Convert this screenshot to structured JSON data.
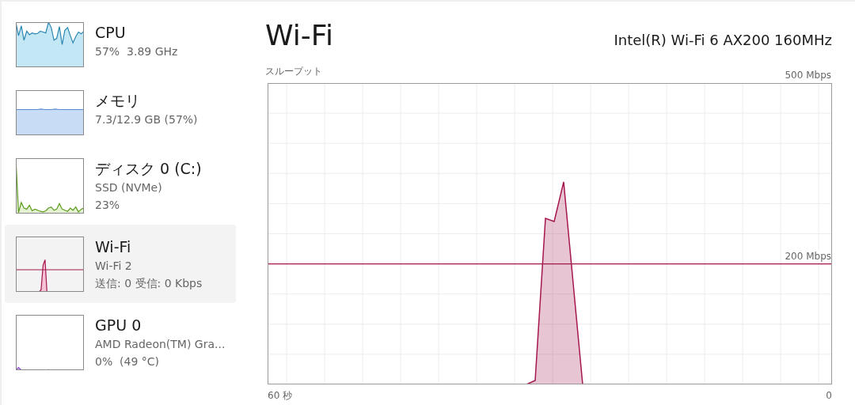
{
  "sidebar": {
    "items": [
      {
        "kind": "cpu",
        "title": "CPU",
        "lines": [
          "57%  3.89 GHz"
        ],
        "selected": false
      },
      {
        "kind": "memory",
        "title": "メモリ",
        "lines": [
          "7.3/12.9 GB (57%)"
        ],
        "selected": false
      },
      {
        "kind": "disk",
        "title": "ディスク 0 (C:)",
        "lines": [
          "SSD (NVMe)",
          "23%"
        ],
        "selected": false
      },
      {
        "kind": "network",
        "title": "Wi-Fi",
        "lines": [
          "Wi-Fi 2",
          "送信: 0 受信: 0 Kbps"
        ],
        "selected": true
      },
      {
        "kind": "gpu",
        "title": "GPU 0",
        "lines": [
          "AMD Radeon(TM) Gra...",
          "0%  (49 °C)"
        ],
        "selected": false
      }
    ]
  },
  "panel": {
    "title": "Wi-Fi",
    "adapter": "Intel(R) Wi-Fi 6 AX200 160MHz",
    "graph": {
      "label": "スループット",
      "scale_max": "500 Mbps",
      "reference": "200 Mbps",
      "time_start": "60 秒",
      "time_end": "0"
    }
  }
}
